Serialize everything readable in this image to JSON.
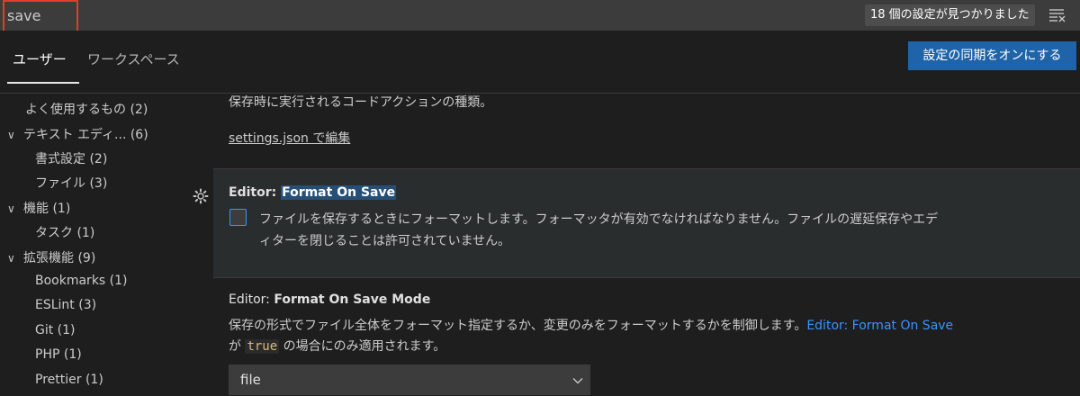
{
  "search": {
    "value": "save",
    "result_count": "18 個の設定が見つかりました"
  },
  "tabs": [
    {
      "label": "ユーザー"
    },
    {
      "label": "ワークスペース"
    }
  ],
  "sync_button": "設定の同期をオンにする",
  "sidebar": {
    "items": [
      {
        "label": "よく使用するもの (2)"
      },
      {
        "label": "テキスト エディ... (6)"
      },
      {
        "label": "書式設定 (2)"
      },
      {
        "label": "ファイル (3)"
      },
      {
        "label": "機能 (1)"
      },
      {
        "label": "タスク (1)"
      },
      {
        "label": "拡張機能 (9)"
      },
      {
        "label": "Bookmarks (1)"
      },
      {
        "label": "ESLint (3)"
      },
      {
        "label": "Git (1)"
      },
      {
        "label": "PHP (1)"
      },
      {
        "label": "Prettier (1)"
      }
    ]
  },
  "content": {
    "prev_description": "保存時に実行されるコードアクションの種類。",
    "settings_link": "settings.json で編集",
    "format_on_save": {
      "category": "Editor: ",
      "title": "Format On Save",
      "description_line1": "ファイルを保存するときにフォーマットします。フォーマッタが有効でなければなりません。ファイルの遅延保存やエデ",
      "description_line2": "ィターを閉じることは許可されていません。"
    },
    "format_on_save_mode": {
      "category": "Editor: ",
      "title": "Format On Save Mode",
      "description_part1": "保存の形式でファイル全体をフォーマット指定するか、変更のみをフォーマットするかを制御します。",
      "description_link": "Editor: Format On Save",
      "description_part2_prefix": "が",
      "description_code": "true",
      "description_part2_suffix": "の場合にのみ適用されます。",
      "dropdown_value": "file"
    }
  },
  "colors": {
    "accent": "#3794ff",
    "button": "#1f64a8",
    "search_highlight_border": "#e23b2a"
  }
}
